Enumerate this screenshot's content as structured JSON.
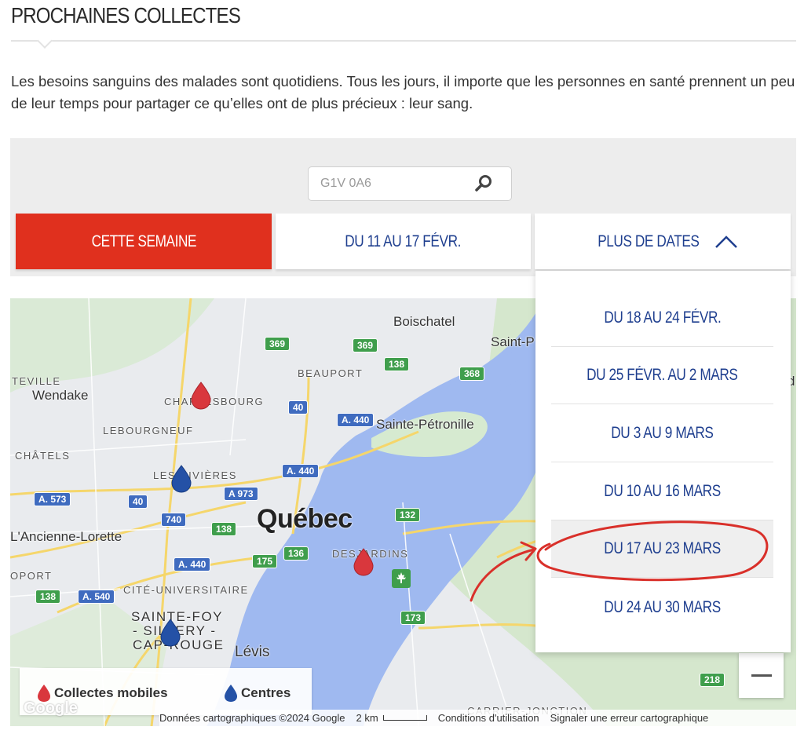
{
  "page": {
    "title": "PROCHAINES COLLECTES",
    "intro": "Les besoins sanguins des malades sont quotidiens. Tous les jours, il importe que les personnes en santé prennent un peu de leur temps pour partager ce qu’elles ont de plus précieux : leur sang."
  },
  "search": {
    "placeholder": "G1V 0A6",
    "icon": "search-icon"
  },
  "tabs": [
    {
      "label": "CETTE SEMAINE",
      "active": true
    },
    {
      "label": "DU 11 AU 17 FÉVR.",
      "active": false
    },
    {
      "label": "PLUS DE DATES",
      "active": false,
      "icon": "chevron-up-icon"
    }
  ],
  "dropdown": {
    "items": [
      {
        "label": "DU 18 AU 24 FÉVR."
      },
      {
        "label": "DU 25 FÉVR. AU 2 MARS"
      },
      {
        "label": "DU 3 AU 9 MARS"
      },
      {
        "label": "DU 10 AU 16 MARS"
      },
      {
        "label": "DU 17 AU 23 MARS",
        "highlighted": true
      },
      {
        "label": "DU 24 AU 30 MARS"
      }
    ]
  },
  "map": {
    "labels": {
      "boischatel": "Boischatel",
      "saint_p": "Saint-P",
      "teville": "TEVILLE",
      "wendake": "Wendake",
      "charlesbourg": "CHARLESBOURG",
      "beauport": "BEAUPORT",
      "lebourgneuf": "LEBOURGNEUF",
      "sainte_petronille": "Sainte-Pétronille",
      "chatels": "CHÂTELS",
      "les_rivieres": "LES RIVIÈRES",
      "quebec": "Québec",
      "ancienne_lorette": "L'Ancienne-Lorette",
      "desjardins": "DESJARDINS",
      "oport": "OPORT",
      "cite_universitaire": "CITÉ-UNIVERSITAIRE",
      "sainte_foy_1": "SAINTE-FOY",
      "sainte_foy_2": "- SILLERY -",
      "sainte_foy_3": "CAP-ROUGE",
      "levis": "Lévis",
      "carrier_jonction": "CARRIER-JONCTION",
      "d": "d"
    },
    "shields": {
      "s369a": "369",
      "s369b": "369",
      "s138a": "138",
      "s368": "368",
      "s40a": "40",
      "a440a": "A. 440",
      "a440b": "A. 440",
      "a440c": "A. 440",
      "a573": "A. 573",
      "s40b": "40",
      "a973": "A 973",
      "s740": "740",
      "s138b": "138",
      "s132": "132",
      "s175": "175",
      "s136": "136",
      "s138c": "138",
      "a540": "A. 540",
      "s173": "173",
      "s218": "218"
    },
    "legend": {
      "mobile": "Collectes mobiles",
      "centres": "Centres"
    },
    "attribution": {
      "google": "Google",
      "data": "Données cartographiques ©2024 Google",
      "scale": "2 km",
      "terms": "Conditions d'utilisation",
      "report": "Signaler une erreur cartographique"
    },
    "colors": {
      "mobile_pin": "#d9373d",
      "centre_pin": "#2451a6",
      "water": "#9fb9f0"
    }
  },
  "colors": {
    "accent": "#e0301e",
    "link": "#1f3f8f",
    "annotation": "#d9302a"
  }
}
